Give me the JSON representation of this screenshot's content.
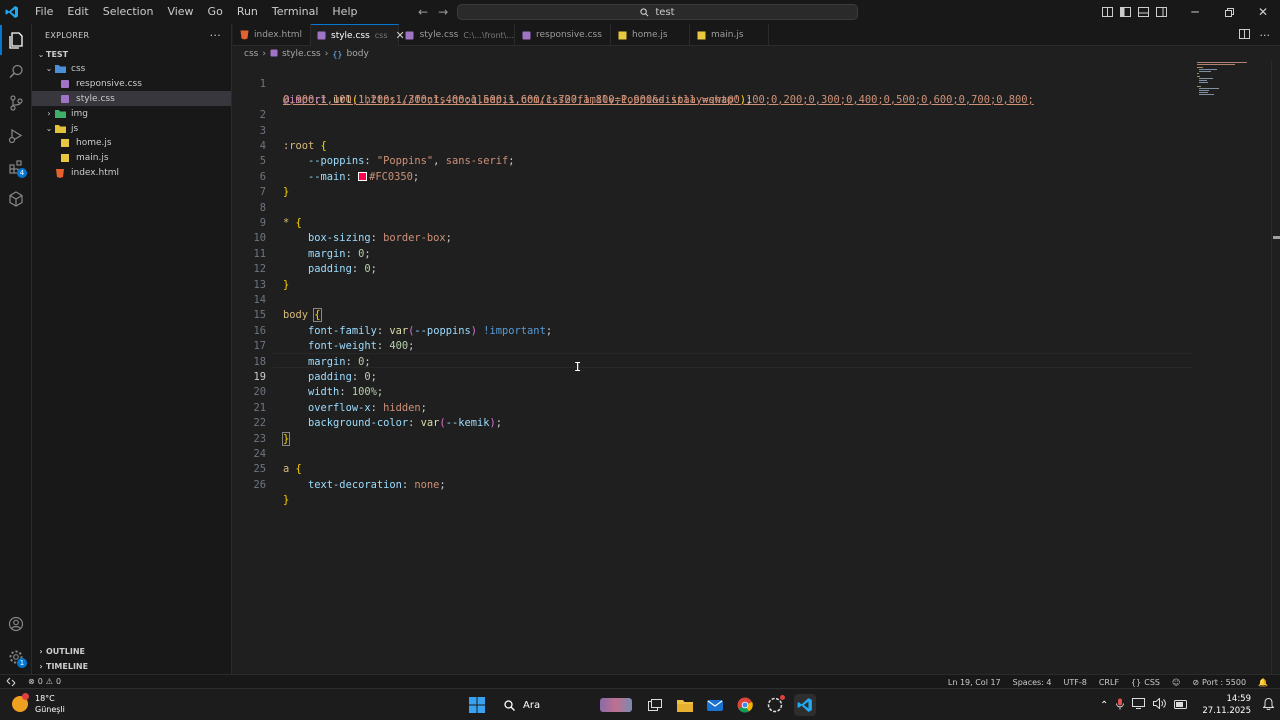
{
  "menu": [
    "File",
    "Edit",
    "Selection",
    "View",
    "Go",
    "Run",
    "Terminal",
    "Help"
  ],
  "search": {
    "text": "test"
  },
  "sidebar": {
    "title": "EXPLORER",
    "root": "TEST",
    "items": [
      {
        "label": "css",
        "kind": "folder"
      },
      {
        "label": "responsive.css",
        "kind": "css"
      },
      {
        "label": "style.css",
        "kind": "css"
      },
      {
        "label": "img",
        "kind": "folder"
      },
      {
        "label": "js",
        "kind": "folder"
      },
      {
        "label": "home.js",
        "kind": "js"
      },
      {
        "label": "main.js",
        "kind": "js"
      },
      {
        "label": "index.html",
        "kind": "html"
      }
    ],
    "outline": "OUTLINE",
    "timeline": "TIMELINE"
  },
  "tabs": [
    {
      "label": "index.html",
      "desc": "",
      "kind": "html"
    },
    {
      "label": "style.css",
      "desc": "css",
      "kind": "css"
    },
    {
      "label": "style.css",
      "desc": "C:\\...\\front\\...",
      "kind": "css"
    },
    {
      "label": "responsive.css",
      "desc": "",
      "kind": "css"
    },
    {
      "label": "home.js",
      "desc": "",
      "kind": "js"
    },
    {
      "label": "main.js",
      "desc": "",
      "kind": "js"
    }
  ],
  "breadcrumb": [
    "css",
    "style.css",
    "body"
  ],
  "code": {
    "line_numbers": [
      "1",
      "2",
      "3",
      "4",
      "5",
      "6",
      "7",
      "8",
      "9",
      "10",
      "11",
      "12",
      "13",
      "14",
      "15",
      "16",
      "17",
      "18",
      "19",
      "20",
      "21",
      "22",
      "23",
      "24",
      "25",
      "26"
    ],
    "import_url": "https://fonts.googleapis.com/css2?family=Poppins:ital,wght@0,100;0,200;0,300;0,400;0,500;0,600;0,700;0,800;",
    "import_url_cont": "0,900;1,100;1,200;1,300;1,400;1,500;1,600;1,700;1,800;1,900&display=swap",
    "main_color": "#FC0350",
    "current_line": "19"
  },
  "status": {
    "errors": "0",
    "warnings": "0",
    "position": "Ln 19, Col 17",
    "spaces": "Spaces: 4",
    "encoding": "UTF-8",
    "eol": "CRLF",
    "language": "CSS",
    "port": "Port : 5500"
  },
  "taskbar": {
    "temperature": "18°C",
    "weather": "Güneşli",
    "search": "Ara",
    "time": "14:59",
    "date": "27.11.2025"
  },
  "colors": {
    "accent": "#0078d4",
    "editor_bg": "#1f1f1f",
    "sidebar_bg": "#181818"
  }
}
